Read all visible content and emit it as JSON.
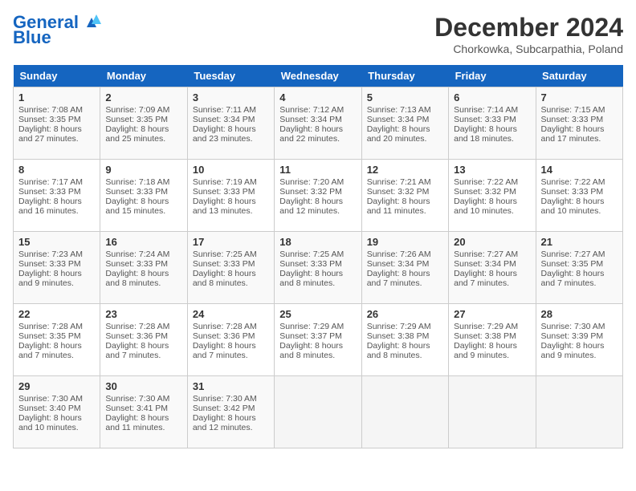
{
  "header": {
    "logo_line1": "General",
    "logo_line2": "Blue",
    "month_title": "December 2024",
    "location": "Chorkowka, Subcarpathia, Poland"
  },
  "days_of_week": [
    "Sunday",
    "Monday",
    "Tuesday",
    "Wednesday",
    "Thursday",
    "Friday",
    "Saturday"
  ],
  "weeks": [
    [
      {
        "day": "1",
        "sunrise": "7:08 AM",
        "sunset": "3:35 PM",
        "daylight": "8 hours and 27 minutes."
      },
      {
        "day": "2",
        "sunrise": "7:09 AM",
        "sunset": "3:35 PM",
        "daylight": "8 hours and 25 minutes."
      },
      {
        "day": "3",
        "sunrise": "7:11 AM",
        "sunset": "3:34 PM",
        "daylight": "8 hours and 23 minutes."
      },
      {
        "day": "4",
        "sunrise": "7:12 AM",
        "sunset": "3:34 PM",
        "daylight": "8 hours and 22 minutes."
      },
      {
        "day": "5",
        "sunrise": "7:13 AM",
        "sunset": "3:34 PM",
        "daylight": "8 hours and 20 minutes."
      },
      {
        "day": "6",
        "sunrise": "7:14 AM",
        "sunset": "3:33 PM",
        "daylight": "8 hours and 18 minutes."
      },
      {
        "day": "7",
        "sunrise": "7:15 AM",
        "sunset": "3:33 PM",
        "daylight": "8 hours and 17 minutes."
      }
    ],
    [
      {
        "day": "8",
        "sunrise": "7:17 AM",
        "sunset": "3:33 PM",
        "daylight": "8 hours and 16 minutes."
      },
      {
        "day": "9",
        "sunrise": "7:18 AM",
        "sunset": "3:33 PM",
        "daylight": "8 hours and 15 minutes."
      },
      {
        "day": "10",
        "sunrise": "7:19 AM",
        "sunset": "3:33 PM",
        "daylight": "8 hours and 13 minutes."
      },
      {
        "day": "11",
        "sunrise": "7:20 AM",
        "sunset": "3:32 PM",
        "daylight": "8 hours and 12 minutes."
      },
      {
        "day": "12",
        "sunrise": "7:21 AM",
        "sunset": "3:32 PM",
        "daylight": "8 hours and 11 minutes."
      },
      {
        "day": "13",
        "sunrise": "7:22 AM",
        "sunset": "3:32 PM",
        "daylight": "8 hours and 10 minutes."
      },
      {
        "day": "14",
        "sunrise": "7:22 AM",
        "sunset": "3:33 PM",
        "daylight": "8 hours and 10 minutes."
      }
    ],
    [
      {
        "day": "15",
        "sunrise": "7:23 AM",
        "sunset": "3:33 PM",
        "daylight": "8 hours and 9 minutes."
      },
      {
        "day": "16",
        "sunrise": "7:24 AM",
        "sunset": "3:33 PM",
        "daylight": "8 hours and 8 minutes."
      },
      {
        "day": "17",
        "sunrise": "7:25 AM",
        "sunset": "3:33 PM",
        "daylight": "8 hours and 8 minutes."
      },
      {
        "day": "18",
        "sunrise": "7:25 AM",
        "sunset": "3:33 PM",
        "daylight": "8 hours and 8 minutes."
      },
      {
        "day": "19",
        "sunrise": "7:26 AM",
        "sunset": "3:34 PM",
        "daylight": "8 hours and 7 minutes."
      },
      {
        "day": "20",
        "sunrise": "7:27 AM",
        "sunset": "3:34 PM",
        "daylight": "8 hours and 7 minutes."
      },
      {
        "day": "21",
        "sunrise": "7:27 AM",
        "sunset": "3:35 PM",
        "daylight": "8 hours and 7 minutes."
      }
    ],
    [
      {
        "day": "22",
        "sunrise": "7:28 AM",
        "sunset": "3:35 PM",
        "daylight": "8 hours and 7 minutes."
      },
      {
        "day": "23",
        "sunrise": "7:28 AM",
        "sunset": "3:36 PM",
        "daylight": "8 hours and 7 minutes."
      },
      {
        "day": "24",
        "sunrise": "7:28 AM",
        "sunset": "3:36 PM",
        "daylight": "8 hours and 7 minutes."
      },
      {
        "day": "25",
        "sunrise": "7:29 AM",
        "sunset": "3:37 PM",
        "daylight": "8 hours and 8 minutes."
      },
      {
        "day": "26",
        "sunrise": "7:29 AM",
        "sunset": "3:38 PM",
        "daylight": "8 hours and 8 minutes."
      },
      {
        "day": "27",
        "sunrise": "7:29 AM",
        "sunset": "3:38 PM",
        "daylight": "8 hours and 9 minutes."
      },
      {
        "day": "28",
        "sunrise": "7:30 AM",
        "sunset": "3:39 PM",
        "daylight": "8 hours and 9 minutes."
      }
    ],
    [
      {
        "day": "29",
        "sunrise": "7:30 AM",
        "sunset": "3:40 PM",
        "daylight": "8 hours and 10 minutes."
      },
      {
        "day": "30",
        "sunrise": "7:30 AM",
        "sunset": "3:41 PM",
        "daylight": "8 hours and 11 minutes."
      },
      {
        "day": "31",
        "sunrise": "7:30 AM",
        "sunset": "3:42 PM",
        "daylight": "8 hours and 12 minutes."
      },
      null,
      null,
      null,
      null
    ]
  ],
  "labels": {
    "sunrise": "Sunrise:",
    "sunset": "Sunset:",
    "daylight": "Daylight:"
  }
}
